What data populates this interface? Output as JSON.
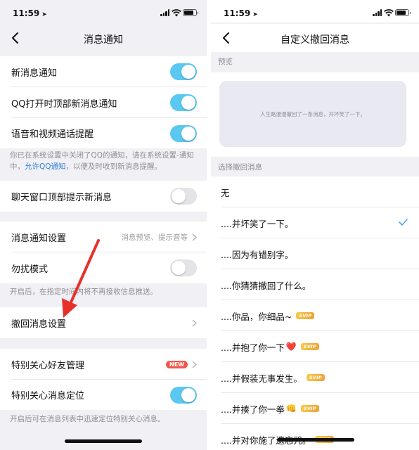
{
  "colors": {
    "accent": "#5ac8f0",
    "link": "#2f7fd8",
    "arrow": "#e8302a",
    "new_badge": "#f0564a",
    "svip": "#f0a23b"
  },
  "left": {
    "status": {
      "time": "11:59"
    },
    "nav": {
      "title": "消息通知"
    },
    "rows": {
      "new_msg": "新消息通知",
      "qq_top": "QQ打开时顶部新消息通知",
      "voice_video": "语音和视频通话提醒",
      "chat_top": "聊天窗口顶部提示新消息",
      "notify_settings": "消息通知设置",
      "notify_settings_value": "消息预览、提示音等",
      "dnd": "勿扰模式",
      "recall": "撤回消息设置",
      "special_friends": "特别关心好友管理",
      "new_badge": "NEW",
      "special_locate": "特别关心消息定位"
    },
    "hints": {
      "system_notify_1": "你已在系统设置中关闭了QQ的通知，请在系统设置-通知中，",
      "system_notify_link": "允许QQ通知",
      "system_notify_2": "，以便及时收到新消息提醒。",
      "dnd": "开启后，在指定时间内将不再接收信息推送。",
      "locate": "开启后可在消息列表中迅速定位特别关心消息。"
    },
    "toggles": {
      "new_msg": true,
      "qq_top": true,
      "voice_video": true,
      "chat_top": false,
      "dnd": false,
      "special_locate": true
    }
  },
  "right": {
    "status": {
      "time": "11:59"
    },
    "nav": {
      "title": "自定义撤回消息"
    },
    "preview_label": "预览",
    "preview_text": "人生路漫漫撤回了一条消息，并坏笑了一下。",
    "select_label": "选择撤回消息",
    "svip_label": "SVIP",
    "options": [
      {
        "label": "无"
      },
      {
        "label": "....并坏笑了一下。",
        "selected": true
      },
      {
        "label": "....因为有错别字。"
      },
      {
        "label": "....你猜猜撤回了什么。"
      },
      {
        "label": "....你品，你细品~",
        "svip": true
      },
      {
        "label": "....并抱了你一下",
        "emoji": "❤️",
        "svip": true
      },
      {
        "label": "....并假装无事发生。",
        "svip": true
      },
      {
        "label": "....并揍了你一拳",
        "emoji": "👊",
        "svip": true
      },
      {
        "label": "....并对你施了遗忘咒。",
        "svip": true
      }
    ]
  }
}
